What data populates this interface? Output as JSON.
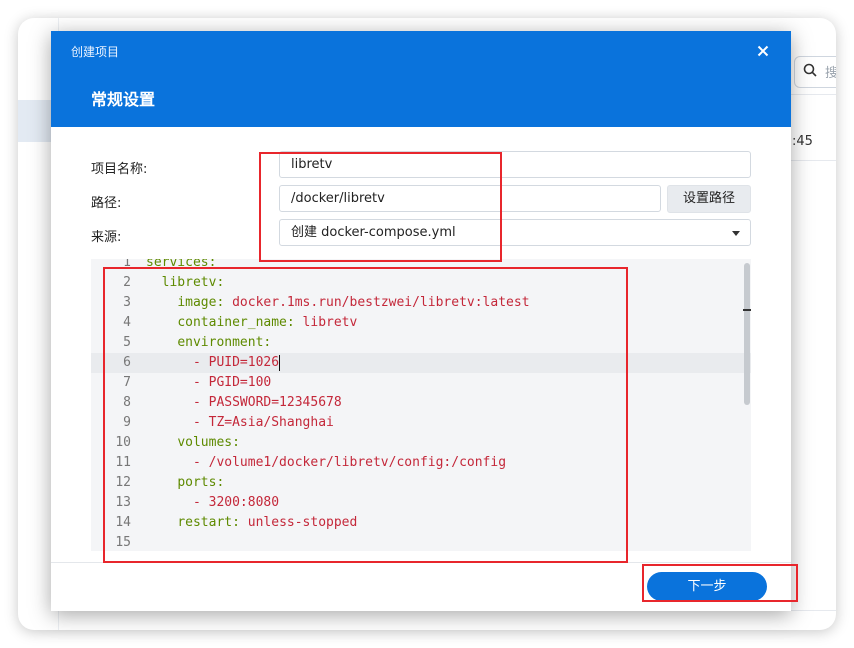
{
  "background": {
    "search_placeholder": "搜",
    "time_fragment": ":45"
  },
  "dialog": {
    "title": "创建项目",
    "subtitle": "常规设置",
    "fields": {
      "name_label": "项目名称:",
      "name_value": "libretv",
      "path_label": "路径:",
      "path_value": "/docker/libretv",
      "set_path_button": "设置路径",
      "source_label": "来源:",
      "source_value": "创建 docker-compose.yml"
    },
    "editor": {
      "active_line": 6,
      "lines": [
        {
          "n": "1",
          "indent": "",
          "key": "services:",
          "val": ""
        },
        {
          "n": "2",
          "indent": "  ",
          "key": "libretv:",
          "val": ""
        },
        {
          "n": "3",
          "indent": "    ",
          "key": "image:",
          "val": " docker.1ms.run/bestzwei/libretv:latest"
        },
        {
          "n": "4",
          "indent": "    ",
          "key": "container_name:",
          "val": " libretv"
        },
        {
          "n": "5",
          "indent": "    ",
          "key": "environment:",
          "val": ""
        },
        {
          "n": "6",
          "indent": "      ",
          "key": "",
          "val": "- PUID=1026"
        },
        {
          "n": "7",
          "indent": "      ",
          "key": "",
          "val": "- PGID=100"
        },
        {
          "n": "8",
          "indent": "      ",
          "key": "",
          "val": "- PASSWORD=12345678"
        },
        {
          "n": "9",
          "indent": "      ",
          "key": "",
          "val": "- TZ=Asia/Shanghai"
        },
        {
          "n": "10",
          "indent": "    ",
          "key": "volumes:",
          "val": ""
        },
        {
          "n": "11",
          "indent": "      ",
          "key": "",
          "val": "- /volume1/docker/libretv/config:/config"
        },
        {
          "n": "12",
          "indent": "    ",
          "key": "ports:",
          "val": ""
        },
        {
          "n": "13",
          "indent": "      ",
          "key": "",
          "val": "- 3200:8080"
        },
        {
          "n": "14",
          "indent": "    ",
          "key": "restart:",
          "val": " unless-stopped"
        },
        {
          "n": "15",
          "indent": "",
          "key": "",
          "val": ""
        }
      ]
    },
    "next_button": "下一步"
  },
  "colors": {
    "header_blue": "#0a73dc",
    "highlight_red": "#e8262c",
    "yaml_key_green": "#5e8a00",
    "yaml_value_red": "#c4283a"
  }
}
